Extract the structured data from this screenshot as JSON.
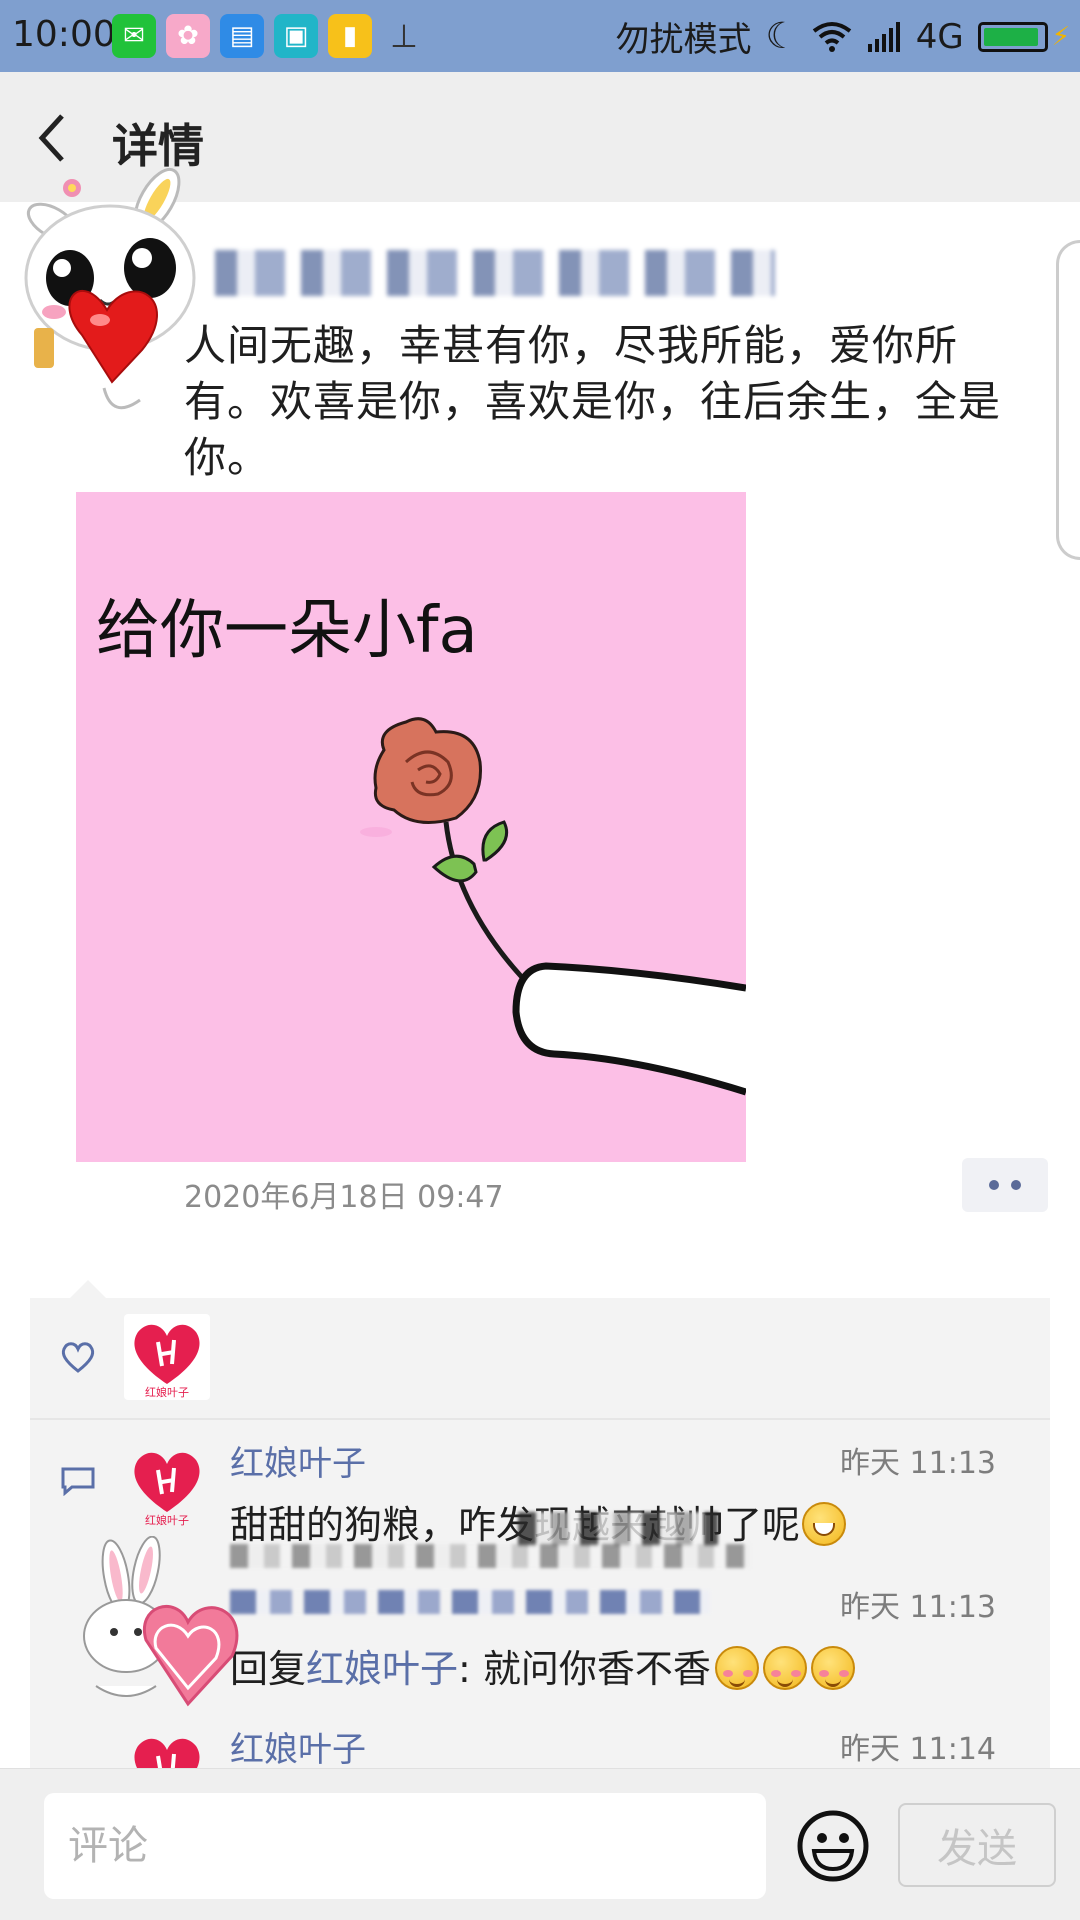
{
  "status_bar": {
    "time": "10:00",
    "dnd_label": "勿扰模式",
    "network_label": "4G",
    "battery_level": 0.85
  },
  "header": {
    "title": "详情"
  },
  "post": {
    "text": "人间无趣，幸甚有你，尽我所能，爱你所有。欢喜是你，喜欢是你，往后余生，全是你。",
    "image_caption": "给你一朵小fa",
    "timestamp": "2020年6月18日 09:47"
  },
  "interactions": {
    "comments": [
      {
        "name": "红娘叶子",
        "time": "昨天 11:13",
        "text": "甜甜的狗粮，咋发现越来越帅了呢"
      },
      {
        "time": "昨天 11:13",
        "reply_prefix": "回复",
        "reply_to": "红娘叶子",
        "text": ": 就问你香不香"
      },
      {
        "name": "红娘叶子",
        "time": "昨天 11:14"
      }
    ],
    "avatar_logo_text": "红娘叶子"
  },
  "bottom_bar": {
    "input_placeholder": "评论",
    "send_label": "发送"
  },
  "colors": {
    "status_bar": "#7f9fcf",
    "header_bg": "#eeeeee",
    "name_blue": "#5a6fa8",
    "image_pink": "#fcbfe6",
    "logo_red": "#e51f4f"
  }
}
